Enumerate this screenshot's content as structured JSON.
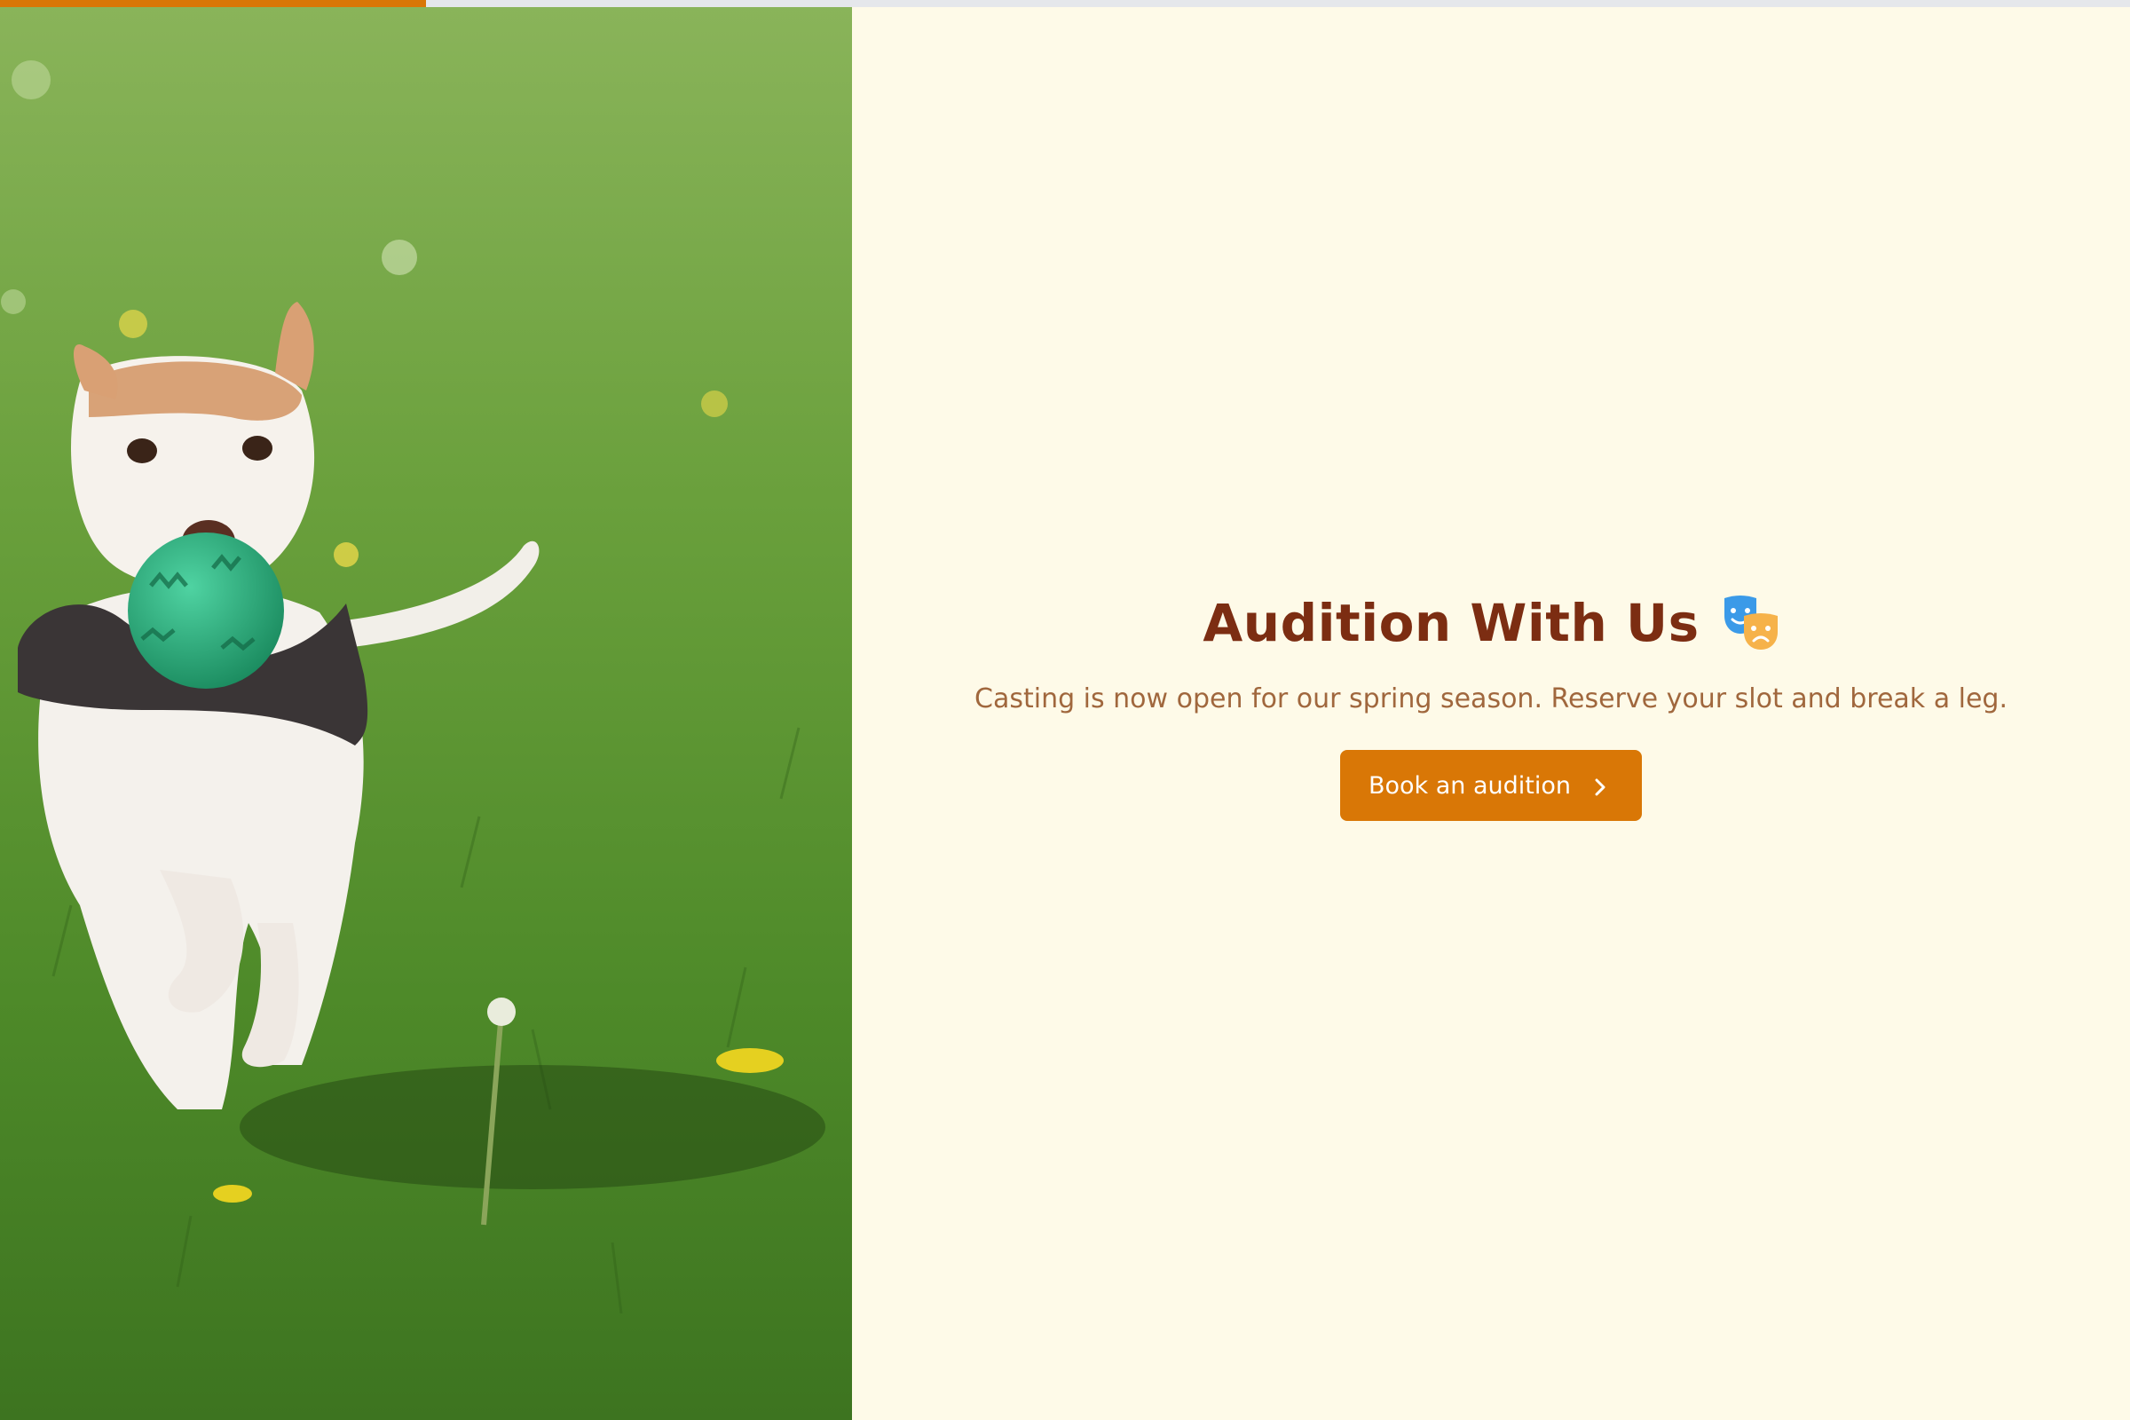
{
  "progress": {
    "value_percent": 20,
    "fill_color": "#d97706",
    "track_color": "#e5e7eb"
  },
  "hero_image": {
    "icon": "dog-photo"
  },
  "content": {
    "headline": "Audition With Us",
    "headline_icon": "theater-masks-icon",
    "subtext": "Casting is now open for our spring season. Reserve your slot and break a leg.",
    "cta_label": "Book an audition",
    "cta_icon": "chevron-right-icon"
  },
  "colors": {
    "background": "#fefae8",
    "headline": "#7c2d12",
    "subtext": "#a0673d",
    "accent": "#d97706"
  }
}
